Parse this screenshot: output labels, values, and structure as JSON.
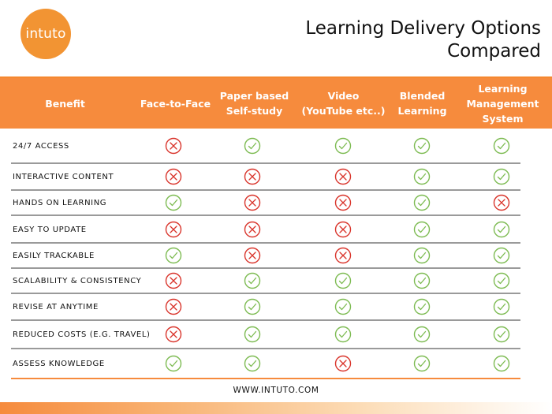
{
  "brand": {
    "logo_text": "intuto",
    "accent_color": "#f68b3d",
    "logo_color": "#f29433"
  },
  "title": {
    "line1": "Learning Delivery Options",
    "line2": "Compared"
  },
  "columns": [
    {
      "key": "benefit",
      "label": "Benefit"
    },
    {
      "key": "face_to_face",
      "label": "Face-to-Face"
    },
    {
      "key": "paper",
      "label": "Paper based\nSelf-study"
    },
    {
      "key": "video",
      "label": "Video\n(YouTube etc..)"
    },
    {
      "key": "blended",
      "label": "Blended\nLearning"
    },
    {
      "key": "lms",
      "label": "Learning\nManagement\nSystem"
    }
  ],
  "status_colors": {
    "yes": "#7dbb52",
    "no": "#d9342b"
  },
  "rows": [
    {
      "benefit": "24/7 ACCESS",
      "values": [
        "no",
        "yes",
        "yes",
        "yes",
        "yes"
      ]
    },
    {
      "benefit": "INTERACTIVE CONTENT",
      "values": [
        "no",
        "no",
        "no",
        "yes",
        "yes"
      ]
    },
    {
      "benefit": "HANDS ON LEARNING",
      "values": [
        "yes",
        "no",
        "no",
        "yes",
        "no"
      ]
    },
    {
      "benefit": "EASY TO UPDATE",
      "values": [
        "no",
        "no",
        "no",
        "yes",
        "yes"
      ]
    },
    {
      "benefit": "EASILY TRACKABLE",
      "values": [
        "yes",
        "no",
        "no",
        "yes",
        "yes"
      ]
    },
    {
      "benefit": "SCALABILITY & CONSISTENCY",
      "values": [
        "no",
        "yes",
        "yes",
        "yes",
        "yes"
      ]
    },
    {
      "benefit": "REVISE AT ANYTIME",
      "values": [
        "no",
        "yes",
        "yes",
        "yes",
        "yes"
      ]
    },
    {
      "benefit": "REDUCED COSTS (E.G. TRAVEL)",
      "values": [
        "no",
        "yes",
        "yes",
        "yes",
        "yes"
      ]
    },
    {
      "benefit": "ASSESS KNOWLEDGE",
      "values": [
        "yes",
        "yes",
        "no",
        "yes",
        "yes"
      ]
    }
  ],
  "icons": {
    "yes": "check-circle-icon",
    "no": "cross-circle-icon"
  },
  "footer": {
    "website": "WWW.INTUTO.COM"
  }
}
